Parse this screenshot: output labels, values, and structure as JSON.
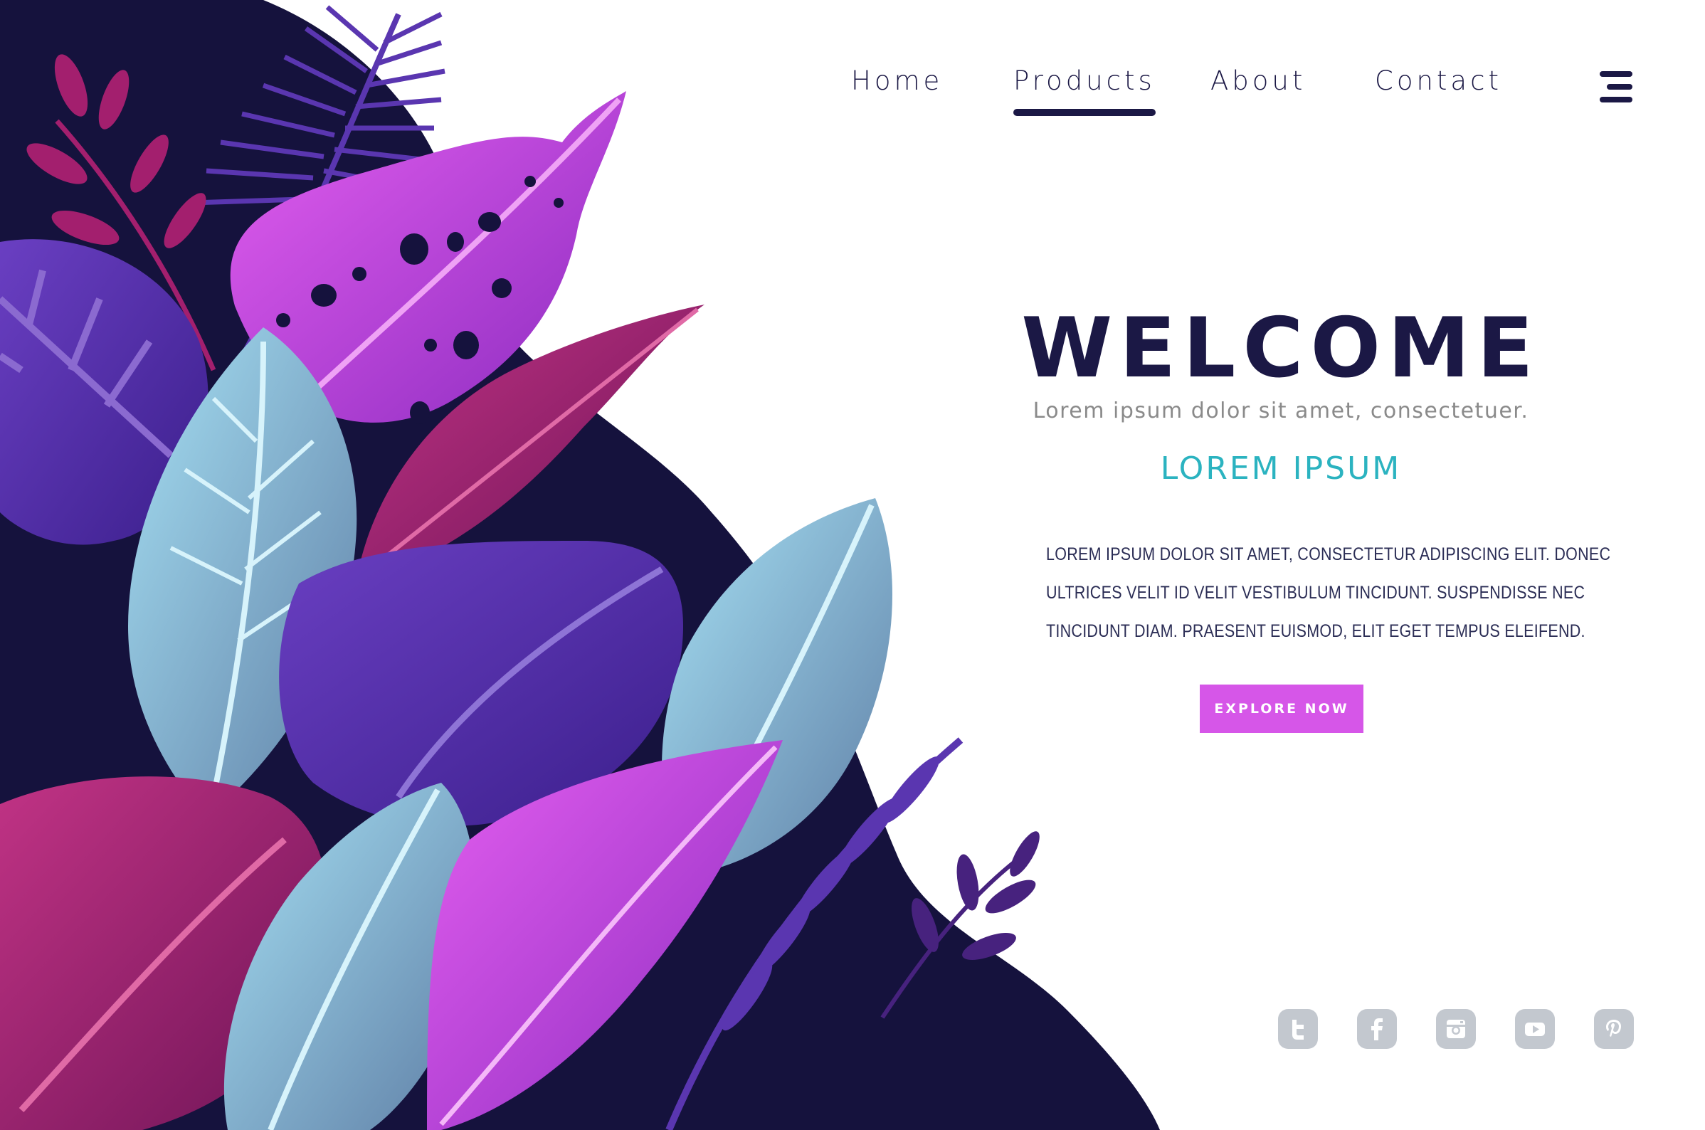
{
  "nav": {
    "items": [
      {
        "label": "Home",
        "active": false
      },
      {
        "label": "Products",
        "active": true
      },
      {
        "label": "About",
        "active": false
      },
      {
        "label": "Contact",
        "active": false
      }
    ],
    "menu_icon": "hamburger-menu-icon"
  },
  "hero": {
    "title": "WELCOME",
    "subtitle": "Lorem ipsum dolor sit amet, consectetuer.",
    "heading": "LOREM IPSUM",
    "body_lines": [
      "Lorem ipsum dolor sit amet, consectetur adipiscing elit. Donec",
      "ultrices velit id velit vestibulum tincidunt. Suspendisse nec",
      "tincidunt diam. Praesent euismod, elit eget tempus eleifend."
    ],
    "cta_label": "EXPLORE NOW"
  },
  "social": [
    "twitter-icon",
    "facebook-icon",
    "instagram-icon",
    "youtube-icon",
    "pinterest-icon"
  ],
  "colors": {
    "navy": "#1b1845",
    "accent_teal": "#2bb3c0",
    "cta": "#d656e8",
    "social_gray": "#c3c8cf",
    "leaf_blue": "#97d6ec",
    "leaf_magenta": "#d45ce8",
    "leaf_purple": "#5a36b0",
    "leaf_crimson": "#9c1f6a"
  }
}
